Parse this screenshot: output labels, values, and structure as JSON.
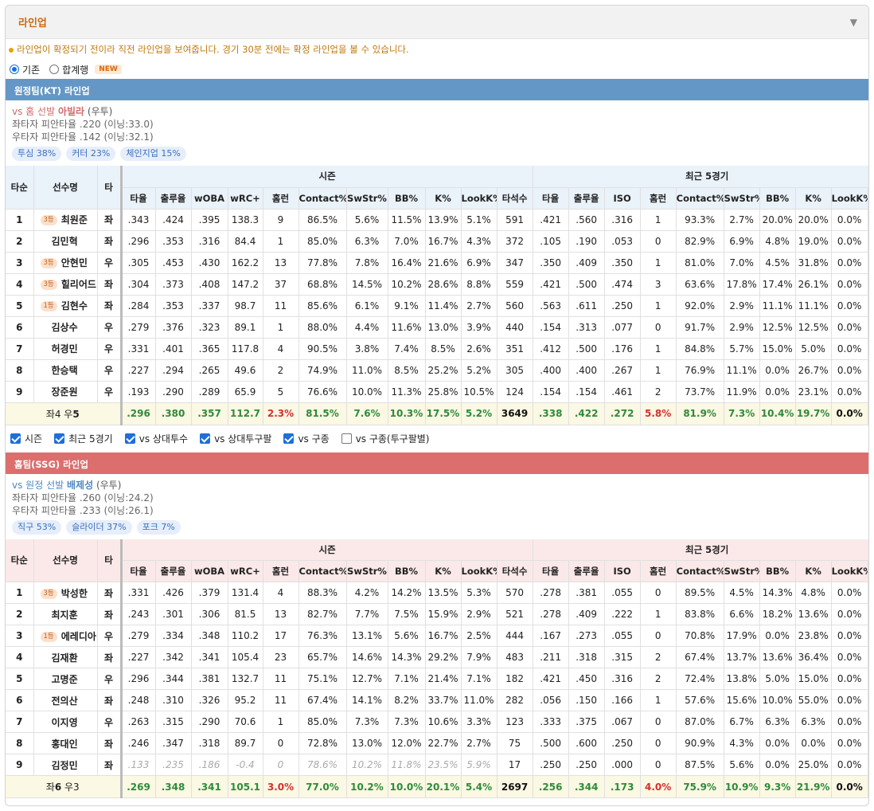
{
  "header": {
    "title": "라인업",
    "collapse_icon": "chevron-down-icon"
  },
  "notice": "라인업이 확정되기 전이라 직전 라인업을 보여줍니다. 경기 30분 전에는 확정 라인업을 볼 수 있습니다.",
  "view_options": {
    "basic": "기존",
    "combined": "합계행",
    "new_badge": "NEW",
    "selected": "기존"
  },
  "columns": {
    "order": "타순",
    "player": "선수명",
    "hand": "타",
    "season": "시즌",
    "recent": "최근 5경기",
    "season_cols": [
      "타율",
      "출루율",
      "wOBA",
      "wRC+",
      "홈런",
      "Contact%",
      "SwStr%",
      "BB%",
      "K%",
      "LookK%",
      "타석수"
    ],
    "recent_cols": [
      "타율",
      "출루율",
      "ISO",
      "홈런",
      "Contact%",
      "SwStr%",
      "BB%",
      "K%",
      "LookK%"
    ]
  },
  "away": {
    "bar": "원정팀(KT) 라인업",
    "pitcher": {
      "vs": "vs 홈 선발",
      "name": "아빌라",
      "hand": "(우투)",
      "vs_left": "좌타자 피안타율 .220 (이닝:33.0)",
      "vs_right": "우타자 피안타율 .142 (이닝:32.1)",
      "pitches": [
        "투심 38%",
        "커터 23%",
        "체인지업 15%"
      ]
    },
    "rows": [
      {
        "no": "1",
        "rank": "3등",
        "name": "최원준",
        "hand": "좌",
        "s": [
          ".343",
          ".424",
          ".395",
          "138.3",
          "9",
          "86.5%",
          "5.6%",
          "11.5%",
          "13.9%",
          "5.1%",
          "591"
        ],
        "r": [
          ".421",
          ".560",
          ".316",
          "1",
          "93.3%",
          "2.7%",
          "20.0%",
          "20.0%",
          "0.0%"
        ]
      },
      {
        "no": "2",
        "rank": "",
        "name": "김민혁",
        "hand": "좌",
        "s": [
          ".296",
          ".353",
          ".316",
          "84.4",
          "1",
          "85.0%",
          "6.3%",
          "7.0%",
          "16.7%",
          "4.3%",
          "372"
        ],
        "r": [
          ".105",
          ".190",
          ".053",
          "0",
          "82.9%",
          "6.9%",
          "4.8%",
          "19.0%",
          "0.0%"
        ]
      },
      {
        "no": "3",
        "rank": "3등",
        "name": "안현민",
        "hand": "우",
        "s": [
          ".305",
          ".453",
          ".430",
          "162.2",
          "13",
          "77.8%",
          "7.8%",
          "16.4%",
          "21.6%",
          "6.9%",
          "347"
        ],
        "r": [
          ".350",
          ".409",
          ".350",
          "1",
          "81.0%",
          "7.0%",
          "4.5%",
          "31.8%",
          "0.0%"
        ]
      },
      {
        "no": "4",
        "rank": "3등",
        "name": "힐리어드",
        "hand": "좌",
        "s": [
          ".304",
          ".373",
          ".408",
          "147.2",
          "37",
          "68.8%",
          "14.5%",
          "10.2%",
          "28.6%",
          "8.8%",
          "559"
        ],
        "r": [
          ".421",
          ".500",
          ".474",
          "3",
          "63.6%",
          "17.8%",
          "17.4%",
          "26.1%",
          "0.0%"
        ]
      },
      {
        "no": "5",
        "rank": "1등",
        "name": "김현수",
        "hand": "좌",
        "s": [
          ".284",
          ".353",
          ".337",
          "98.7",
          "11",
          "85.6%",
          "6.1%",
          "9.1%",
          "11.4%",
          "2.7%",
          "560"
        ],
        "r": [
          ".563",
          ".611",
          ".250",
          "1",
          "92.0%",
          "2.9%",
          "11.1%",
          "11.1%",
          "0.0%"
        ]
      },
      {
        "no": "6",
        "rank": "",
        "name": "김상수",
        "hand": "우",
        "s": [
          ".279",
          ".376",
          ".323",
          "89.1",
          "1",
          "88.0%",
          "4.4%",
          "11.6%",
          "13.0%",
          "3.9%",
          "440"
        ],
        "r": [
          ".154",
          ".313",
          ".077",
          "0",
          "91.7%",
          "2.9%",
          "12.5%",
          "12.5%",
          "0.0%"
        ]
      },
      {
        "no": "7",
        "rank": "",
        "name": "허경민",
        "hand": "우",
        "s": [
          ".331",
          ".401",
          ".365",
          "117.8",
          "4",
          "90.5%",
          "3.8%",
          "7.4%",
          "8.5%",
          "2.6%",
          "351"
        ],
        "r": [
          ".412",
          ".500",
          ".176",
          "1",
          "84.8%",
          "5.7%",
          "15.0%",
          "5.0%",
          "0.0%"
        ]
      },
      {
        "no": "8",
        "rank": "",
        "name": "한승택",
        "hand": "우",
        "s": [
          ".227",
          ".294",
          ".265",
          "49.6",
          "2",
          "74.9%",
          "11.0%",
          "8.5%",
          "25.2%",
          "5.2%",
          "305"
        ],
        "r": [
          ".400",
          ".400",
          ".267",
          "1",
          "76.9%",
          "11.1%",
          "0.0%",
          "26.7%",
          "0.0%"
        ]
      },
      {
        "no": "9",
        "rank": "",
        "name": "장준원",
        "hand": "우",
        "s": [
          ".193",
          ".290",
          ".289",
          "65.9",
          "5",
          "76.6%",
          "10.0%",
          "11.3%",
          "25.8%",
          "10.5%",
          "124"
        ],
        "r": [
          ".154",
          ".154",
          ".461",
          "2",
          "73.7%",
          "11.9%",
          "0.0%",
          "23.1%",
          "0.0%"
        ]
      }
    ],
    "sum": {
      "label_pre": "좌4 우",
      "label_bold": "5",
      "s": [
        ".296",
        ".380",
        ".357",
        "112.7",
        "2.3%",
        "81.5%",
        "7.6%",
        "10.3%",
        "17.5%",
        "5.2%",
        "3649"
      ],
      "r": [
        ".338",
        ".422",
        ".272",
        "5.8%",
        "81.9%",
        "7.3%",
        "10.4%",
        "19.7%",
        "0.0%"
      ]
    }
  },
  "filters": [
    {
      "label": "시즌",
      "checked": true
    },
    {
      "label": "최근 5경기",
      "checked": true
    },
    {
      "label": "vs 상대투수",
      "checked": true
    },
    {
      "label": "vs 상대투구팔",
      "checked": true
    },
    {
      "label": "vs 구종",
      "checked": true
    },
    {
      "label": "vs 구종(투구팔별)",
      "checked": false
    }
  ],
  "home": {
    "bar": "홈팀(SSG) 라인업",
    "pitcher": {
      "vs": "vs 원정 선발",
      "name": "배제성",
      "hand": "(우투)",
      "vs_left": "좌타자 피안타율 .260 (이닝:24.2)",
      "vs_right": "우타자 피안타율 .233 (이닝:26.1)",
      "pitches": [
        "직구 53%",
        "슬라이더 37%",
        "포크 7%"
      ]
    },
    "rows": [
      {
        "no": "1",
        "rank": "3등",
        "name": "박성한",
        "hand": "좌",
        "s": [
          ".331",
          ".426",
          ".379",
          "131.4",
          "4",
          "88.3%",
          "4.2%",
          "14.2%",
          "13.5%",
          "5.3%",
          "570"
        ],
        "r": [
          ".278",
          ".381",
          ".055",
          "0",
          "89.5%",
          "4.5%",
          "14.3%",
          "4.8%",
          "0.0%"
        ]
      },
      {
        "no": "2",
        "rank": "",
        "name": "최지훈",
        "hand": "좌",
        "s": [
          ".243",
          ".301",
          ".306",
          "81.5",
          "13",
          "82.7%",
          "7.7%",
          "7.5%",
          "15.9%",
          "2.9%",
          "521"
        ],
        "r": [
          ".278",
          ".409",
          ".222",
          "1",
          "83.8%",
          "6.6%",
          "18.2%",
          "13.6%",
          "0.0%"
        ]
      },
      {
        "no": "3",
        "rank": "1등",
        "name": "에레디아",
        "hand": "우",
        "s": [
          ".279",
          ".334",
          ".348",
          "110.2",
          "17",
          "76.3%",
          "13.1%",
          "5.6%",
          "16.7%",
          "2.5%",
          "444"
        ],
        "r": [
          ".167",
          ".273",
          ".055",
          "0",
          "70.8%",
          "17.9%",
          "0.0%",
          "23.8%",
          "0.0%"
        ]
      },
      {
        "no": "4",
        "rank": "",
        "name": "김재환",
        "hand": "좌",
        "s": [
          ".227",
          ".342",
          ".341",
          "105.4",
          "23",
          "65.7%",
          "14.6%",
          "14.3%",
          "29.2%",
          "7.9%",
          "483"
        ],
        "r": [
          ".211",
          ".318",
          ".315",
          "2",
          "67.4%",
          "13.7%",
          "13.6%",
          "36.4%",
          "0.0%"
        ]
      },
      {
        "no": "5",
        "rank": "",
        "name": "고명준",
        "hand": "우",
        "s": [
          ".296",
          ".344",
          ".381",
          "132.7",
          "11",
          "75.1%",
          "12.7%",
          "7.1%",
          "21.4%",
          "7.1%",
          "182"
        ],
        "r": [
          ".421",
          ".450",
          ".316",
          "2",
          "72.4%",
          "13.8%",
          "5.0%",
          "15.0%",
          "0.0%"
        ]
      },
      {
        "no": "6",
        "rank": "",
        "name": "전의산",
        "hand": "좌",
        "s": [
          ".248",
          ".310",
          ".326",
          "95.2",
          "11",
          "67.4%",
          "14.1%",
          "8.2%",
          "33.7%",
          "11.0%",
          "282"
        ],
        "r": [
          ".056",
          ".150",
          ".166",
          "1",
          "57.6%",
          "15.6%",
          "10.0%",
          "55.0%",
          "0.0%"
        ]
      },
      {
        "no": "7",
        "rank": "",
        "name": "이지영",
        "hand": "우",
        "s": [
          ".263",
          ".315",
          ".290",
          "70.6",
          "1",
          "85.0%",
          "7.3%",
          "7.3%",
          "10.6%",
          "3.3%",
          "123"
        ],
        "r": [
          ".333",
          ".375",
          ".067",
          "0",
          "87.0%",
          "6.7%",
          "6.3%",
          "6.3%",
          "0.0%"
        ]
      },
      {
        "no": "8",
        "rank": "",
        "name": "홍대인",
        "hand": "좌",
        "s": [
          ".246",
          ".347",
          ".318",
          "89.7",
          "0",
          "72.8%",
          "13.0%",
          "12.0%",
          "22.7%",
          "2.7%",
          "75"
        ],
        "r": [
          ".500",
          ".600",
          ".250",
          "0",
          "90.9%",
          "4.3%",
          "0.0%",
          "0.0%",
          "0.0%"
        ]
      },
      {
        "no": "9",
        "rank": "",
        "name": "김정민",
        "hand": "좌",
        "muted": true,
        "s": [
          ".133",
          ".235",
          ".186",
          "-0.4",
          "0",
          "78.6%",
          "10.2%",
          "11.8%",
          "23.5%",
          "5.9%",
          "17"
        ],
        "r": [
          ".250",
          ".250",
          ".000",
          "0",
          "87.5%",
          "5.6%",
          "0.0%",
          "25.0%",
          "0.0%"
        ]
      }
    ],
    "sum": {
      "label_pre": "좌",
      "label_bold": "6",
      "label_post": " 우3",
      "s": [
        ".269",
        ".348",
        ".341",
        "105.1",
        "3.0%",
        "77.0%",
        "10.2%",
        "10.0%",
        "20.1%",
        "5.4%",
        "2697"
      ],
      "r": [
        ".256",
        ".344",
        ".173",
        "4.0%",
        "75.9%",
        "10.9%",
        "9.3%",
        "21.9%",
        "0.0%"
      ]
    }
  },
  "colors": {
    "away_bar": "#6497c6",
    "home_bar": "#dc6e6e",
    "green": "#2e8b3a",
    "red": "#d43030",
    "title": "#c96a12"
  }
}
